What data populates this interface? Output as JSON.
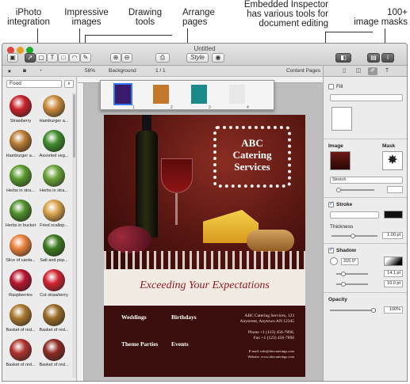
{
  "callouts": [
    {
      "text": "iPhoto\nintegration"
    },
    {
      "text": "Impressive\nimages"
    },
    {
      "text": "Drawing\ntools"
    },
    {
      "text": "Arrange\npages"
    },
    {
      "text": "Embedded Inspector\nhas various tools for\ndocument editing"
    },
    {
      "text": "100+\nimage masks"
    }
  ],
  "window": {
    "title": "Untitled"
  },
  "toolbar": {
    "zoom": "58%",
    "background_select": "Background",
    "page_counter": "1 / 1",
    "content_pages": "Content Pages",
    "style_label": "Style"
  },
  "sidebar": {
    "category": "Food",
    "items": [
      {
        "label": "Strawberry",
        "color": "#c8202a"
      },
      {
        "label": "Hamburger a...",
        "color": "#c98a3a"
      },
      {
        "label": "Hamburger a...",
        "color": "#b87a33"
      },
      {
        "label": "Assorted veg...",
        "color": "#3f8a2a"
      },
      {
        "label": "Herbs in stra...",
        "color": "#5a9a2e"
      },
      {
        "label": "Herbs in stra...",
        "color": "#6aa236"
      },
      {
        "label": "Herbs in bucket",
        "color": "#4f8f2c"
      },
      {
        "label": "Fried scallop...",
        "color": "#d9a24a"
      },
      {
        "label": "Slice of canta...",
        "color": "#e8803a"
      },
      {
        "label": "Salt and pep...",
        "color": "#3d7a1e"
      },
      {
        "label": "Raspberries",
        "color": "#b8142e"
      },
      {
        "label": "Cut strawberry",
        "color": "#d2232f"
      },
      {
        "label": "Basket of red...",
        "color": "#a8782e"
      },
      {
        "label": "Basket of red...",
        "color": "#9a6a28"
      },
      {
        "label": "Basket of red...",
        "color": "#b0322c"
      },
      {
        "label": "Basket of red...",
        "color": "#8e2a22"
      }
    ]
  },
  "pages": [
    {
      "num": "1",
      "color": "#3a1a6a"
    },
    {
      "num": "2",
      "color": "#c4782a"
    },
    {
      "num": "3",
      "color": "#1a8a8a"
    },
    {
      "num": "4",
      "color": "#e8e8e8"
    }
  ],
  "document": {
    "logo_title": "ABC\nCatering\nServices",
    "banner": "Exceeding Your Expectations",
    "col1_heading1": "Weddings",
    "col1_heading2": "Theme Parties",
    "col2_heading1": "Birthdays",
    "col2_heading2": "Events",
    "address": "ABC Catering Services, 123\nAnystreet, Anytown AN 12345",
    "phone": "Phone +1 (123) 456-7890,\nFax +1 (123) 456-7890",
    "email": "E-mail: info@abccaterings.com\nWebsite: www.abccaterings.com"
  },
  "inspector": {
    "fill_label": "Fill",
    "image_label": "Image",
    "mask_label": "Mask",
    "stretch_select": "Stretch",
    "stroke_label": "Stroke",
    "thickness_label": "Thickness",
    "thickness_value": "1.00 pt",
    "shadow_label": "Shadow",
    "angle_value": "315.0°",
    "shadow_size": "14.1 pt",
    "shadow_blur": "10.0 pt",
    "opacity_label": "Opacity",
    "opacity_value": "100%",
    "fill_checked": false,
    "stroke_checked": true,
    "shadow_checked": true
  }
}
